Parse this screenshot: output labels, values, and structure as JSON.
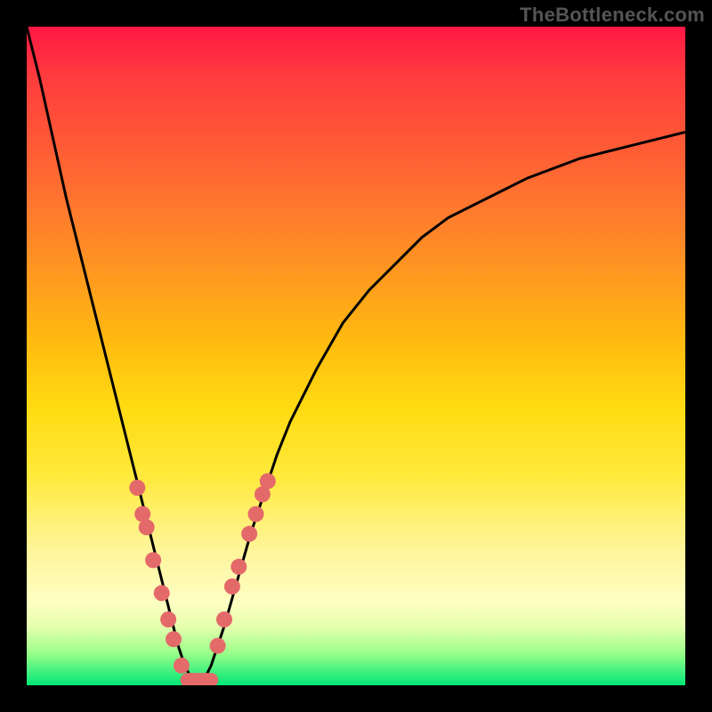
{
  "watermark": "TheBottleneck.com",
  "colors": {
    "frame": "#000000",
    "curve_stroke": "#000000",
    "marker_fill": "#e46a6a",
    "gradient_top": "#ff1744",
    "gradient_bottom": "#00e676"
  },
  "chart_data": {
    "type": "line",
    "title": "",
    "xlabel": "",
    "ylabel": "",
    "xlim": [
      0,
      100
    ],
    "ylim": [
      0,
      100
    ],
    "grid": false,
    "legend": false,
    "x": [
      0,
      2,
      4,
      6,
      8,
      10,
      12,
      14,
      16,
      18,
      20,
      22,
      23,
      24,
      25,
      26,
      27,
      28,
      30,
      32,
      34,
      36,
      38,
      40,
      44,
      48,
      52,
      56,
      60,
      64,
      68,
      72,
      76,
      80,
      84,
      88,
      92,
      96,
      100
    ],
    "values": [
      100,
      92,
      83,
      74,
      66,
      58,
      50,
      42,
      34,
      26,
      18,
      10,
      6,
      3,
      1,
      0,
      1,
      3,
      9,
      16,
      23,
      29,
      35,
      40,
      48,
      55,
      60,
      64,
      68,
      71,
      73,
      75,
      77,
      78.5,
      80,
      81,
      82,
      83,
      84
    ],
    "note": "V-shaped curve with minimum near x≈26; right side rises with diminishing slope.",
    "markers": {
      "left_arm": [
        {
          "x": 16.8,
          "y": 30
        },
        {
          "x": 17.6,
          "y": 26
        },
        {
          "x": 18.2,
          "y": 24
        },
        {
          "x": 19.2,
          "y": 19
        },
        {
          "x": 20.5,
          "y": 14
        },
        {
          "x": 21.5,
          "y": 10
        },
        {
          "x": 22.3,
          "y": 7
        },
        {
          "x": 23.5,
          "y": 3
        }
      ],
      "bottom": [
        {
          "x": 24.4,
          "y": 1.5
        },
        {
          "x": 25.2,
          "y": 1
        },
        {
          "x": 26.2,
          "y": 0.8
        },
        {
          "x": 27.2,
          "y": 1.2
        },
        {
          "x": 28.0,
          "y": 1.8
        }
      ],
      "right_arm": [
        {
          "x": 29.0,
          "y": 6
        },
        {
          "x": 30.0,
          "y": 10
        },
        {
          "x": 31.2,
          "y": 15
        },
        {
          "x": 32.2,
          "y": 18
        },
        {
          "x": 33.8,
          "y": 23
        },
        {
          "x": 34.8,
          "y": 26
        },
        {
          "x": 35.8,
          "y": 29
        },
        {
          "x": 36.6,
          "y": 31
        }
      ]
    }
  }
}
